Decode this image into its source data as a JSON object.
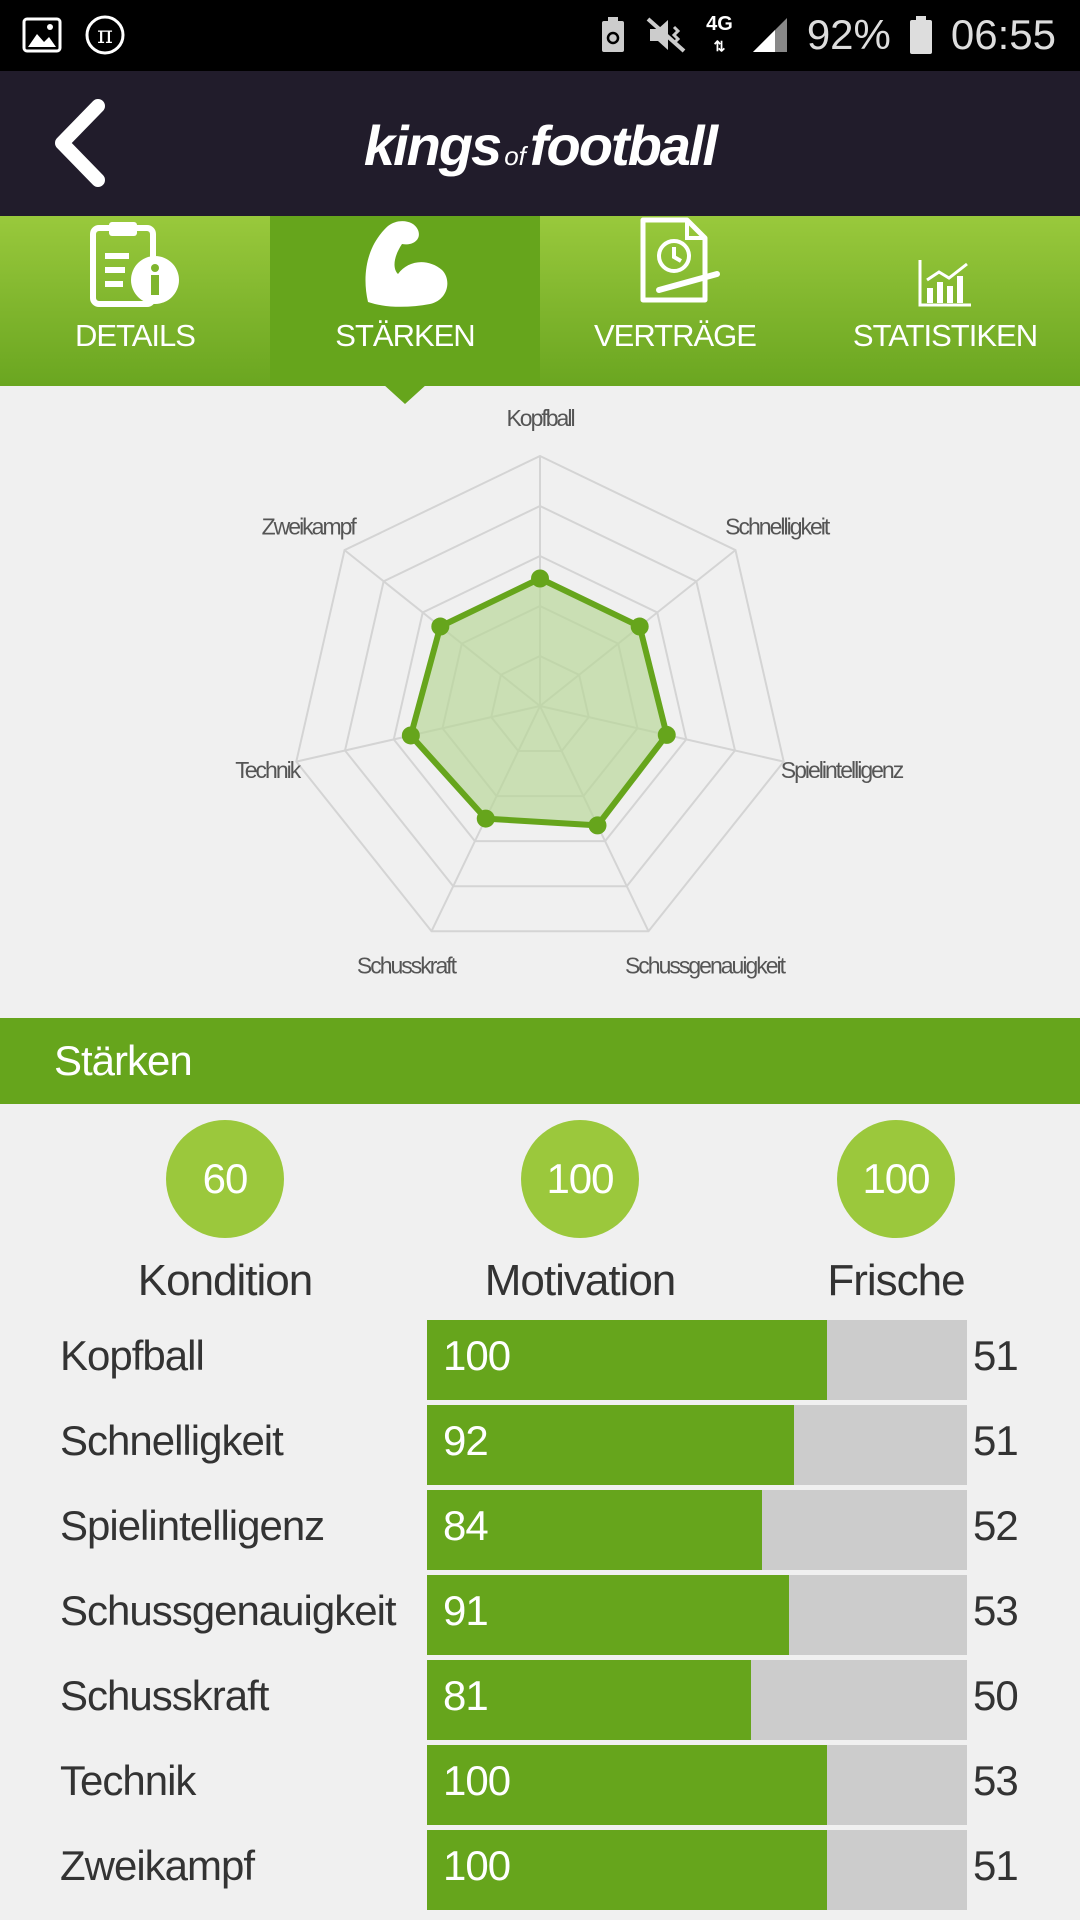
{
  "status_bar": {
    "battery": "92%",
    "time": "06:55",
    "network": "4G",
    "icons": [
      "image-icon",
      "pi-icon",
      "battery-saver-icon",
      "mute-vibrate-icon",
      "network-icon",
      "signal-icon",
      "battery-icon"
    ]
  },
  "header": {
    "logo_part1": "kings",
    "logo_of": "of",
    "logo_part2": "football"
  },
  "tabs": [
    {
      "label": "DETAILS",
      "icon": "clipboard-info-icon",
      "active": false
    },
    {
      "label": "STÄRKEN",
      "icon": "flexed-bicep-icon",
      "active": true
    },
    {
      "label": "VERTRÄGE",
      "icon": "contract-clock-icon",
      "active": false
    },
    {
      "label": "STATISTIKEN",
      "icon": "bar-chart-icon",
      "active": false
    }
  ],
  "chart_data": {
    "type": "radar",
    "axes": [
      "Kopfball",
      "Schnelligkeit",
      "Spielintelligenz",
      "Schussgenauigkeit",
      "Schusskraft",
      "Technik",
      "Zweikampf"
    ],
    "values": [
      51,
      51,
      52,
      53,
      50,
      53,
      51
    ],
    "range": [
      0,
      100
    ],
    "rings": 5,
    "colors": {
      "fill": "#b9d79a",
      "stroke": "#66a51c",
      "grid": "#d4d4d4"
    }
  },
  "section": {
    "title": "Stärken"
  },
  "circles": [
    {
      "value": "60",
      "label": "Kondition"
    },
    {
      "value": "100",
      "label": "Motivation"
    },
    {
      "value": "100",
      "label": "Frische"
    }
  ],
  "bars": [
    {
      "label": "Kopfball",
      "max": 100,
      "current": 51,
      "fill_fraction": 0.74
    },
    {
      "label": "Schnelligkeit",
      "max": 92,
      "current": 51,
      "fill_fraction": 0.68
    },
    {
      "label": "Spielintelligenz",
      "max": 84,
      "current": 52,
      "fill_fraction": 0.62
    },
    {
      "label": "Schussgenauigkeit",
      "max": 91,
      "current": 53,
      "fill_fraction": 0.67
    },
    {
      "label": "Schusskraft",
      "max": 81,
      "current": 50,
      "fill_fraction": 0.6
    },
    {
      "label": "Technik",
      "max": 100,
      "current": 53,
      "fill_fraction": 0.74
    },
    {
      "label": "Zweikampf",
      "max": 100,
      "current": 51,
      "fill_fraction": 0.74
    }
  ],
  "colors": {
    "accent": "#66a51c",
    "accent_light": "#9bc83c",
    "header_bg": "#211c2b",
    "track": "#cccccc"
  }
}
